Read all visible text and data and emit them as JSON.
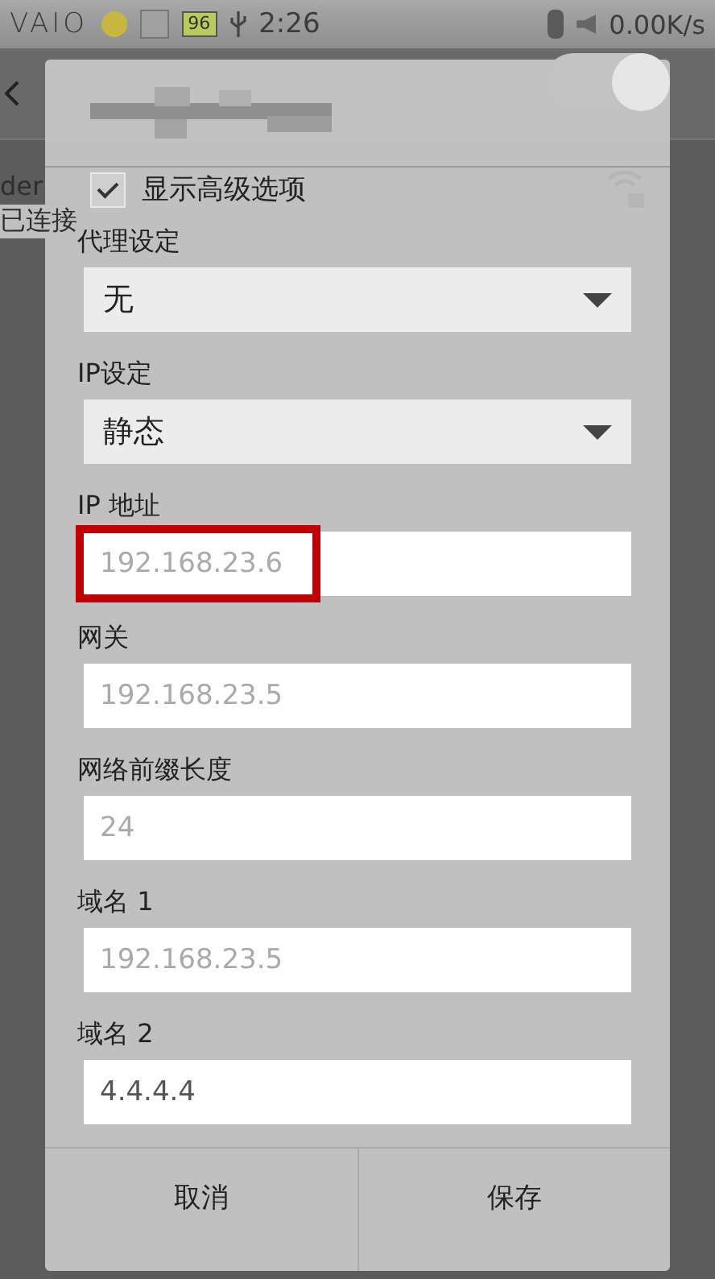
{
  "status_bar": {
    "brand": "VAIO",
    "battery": "96",
    "time": "2:26",
    "speed": "0.00K/s"
  },
  "background": {
    "network_name": "der",
    "network_status": "已连接"
  },
  "dialog": {
    "toggle": {
      "on": true
    },
    "advanced": {
      "label": "显示高级选项",
      "checked": true
    },
    "fields": [
      {
        "kind": "dropdown",
        "label": "代理设定",
        "value": "无"
      },
      {
        "kind": "dropdown",
        "label": "IP设定",
        "value": "静态"
      },
      {
        "kind": "text",
        "label": "IP 地址",
        "placeholder": "192.168.23.6",
        "highlighted": true
      },
      {
        "kind": "text",
        "label": "网关",
        "placeholder": "192.168.23.5",
        "highlighted": false
      },
      {
        "kind": "text",
        "label": "网络前缀长度",
        "placeholder": "24",
        "highlighted": false
      },
      {
        "kind": "text",
        "label": "域名 1",
        "placeholder": "192.168.23.5",
        "highlighted": false
      },
      {
        "kind": "text",
        "label": "域名 2",
        "value": "4.4.4.4",
        "highlighted": false
      }
    ],
    "buttons": [
      "取消",
      "保存"
    ]
  }
}
